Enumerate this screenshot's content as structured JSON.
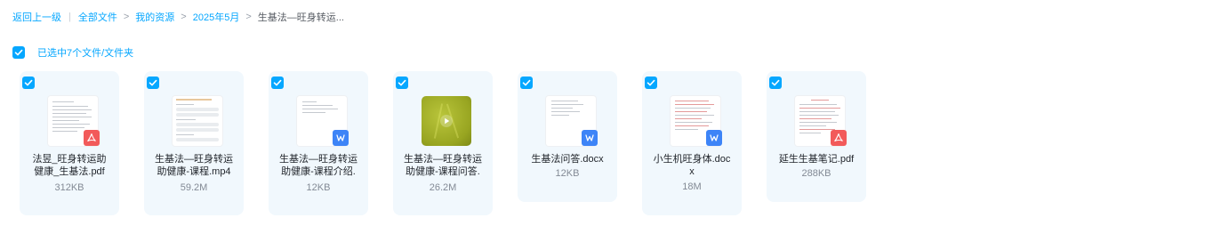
{
  "breadcrumb": {
    "back": "返回上一级",
    "items": [
      "全部文件",
      "我的资源",
      "2025年5月"
    ],
    "current": "生基法—旺身转运..."
  },
  "selection": {
    "text": "已选中7个文件/文件夹",
    "checked": true
  },
  "files": [
    {
      "name_line1": "法昱_旺身转运助",
      "name_line2": "健康_生基法.pdf",
      "size": "312KB",
      "type": "pdf",
      "icon": "pdf-icon",
      "checked": true
    },
    {
      "name_line1": "生基法—旺身转运",
      "name_line2": "助健康-课程.mp4",
      "size": "59.2M",
      "type": "doc-preview",
      "icon": "none",
      "checked": true
    },
    {
      "name_line1": "生基法—旺身转运",
      "name_line2": "助健康-课程介绍.",
      "size": "12KB",
      "type": "word",
      "icon": "word-icon",
      "checked": true
    },
    {
      "name_line1": "生基法—旺身转运",
      "name_line2": "助健康-课程问答.",
      "size": "26.2M",
      "type": "video",
      "icon": "play-icon",
      "checked": true
    },
    {
      "name_line1": "生基法问答.docx",
      "name_line2": "",
      "size": "12KB",
      "type": "word",
      "icon": "word-icon",
      "checked": true
    },
    {
      "name_line1": "小生机旺身体.doc",
      "name_line2": "x",
      "size": "18M",
      "type": "word",
      "icon": "word-icon",
      "checked": true
    },
    {
      "name_line1": "延生生基笔记.pdf",
      "name_line2": "",
      "size": "288KB",
      "type": "pdf",
      "icon": "pdf-icon",
      "checked": true
    }
  ],
  "colors": {
    "accent": "#06a7ff",
    "card_bg": "#f1f8fd",
    "pdf": "#f25a5a",
    "word": "#3d84f7"
  }
}
